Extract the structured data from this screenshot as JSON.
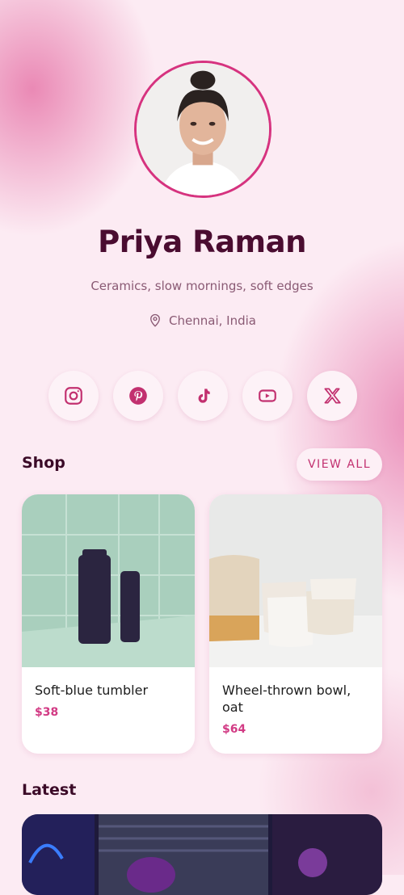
{
  "profile": {
    "name": "Priya Raman",
    "bio": "Ceramics, slow mornings, soft edges",
    "location": "Chennai, India"
  },
  "socials": [
    {
      "icon": "instagram-icon"
    },
    {
      "icon": "pinterest-icon"
    },
    {
      "icon": "tiktok-icon"
    },
    {
      "icon": "youtube-icon"
    },
    {
      "icon": "x-icon"
    }
  ],
  "shop": {
    "title": "Shop",
    "view_all_label": "VIEW ALL",
    "products": [
      {
        "title": "Soft-blue tumbler",
        "price": "$38"
      },
      {
        "title": "Wheel-thrown bowl, oat",
        "price": "$64"
      }
    ]
  },
  "latest": {
    "title": "Latest"
  },
  "colors": {
    "accent": "#d6337f",
    "heading": "#4a0c30",
    "price": "#d23a84"
  }
}
